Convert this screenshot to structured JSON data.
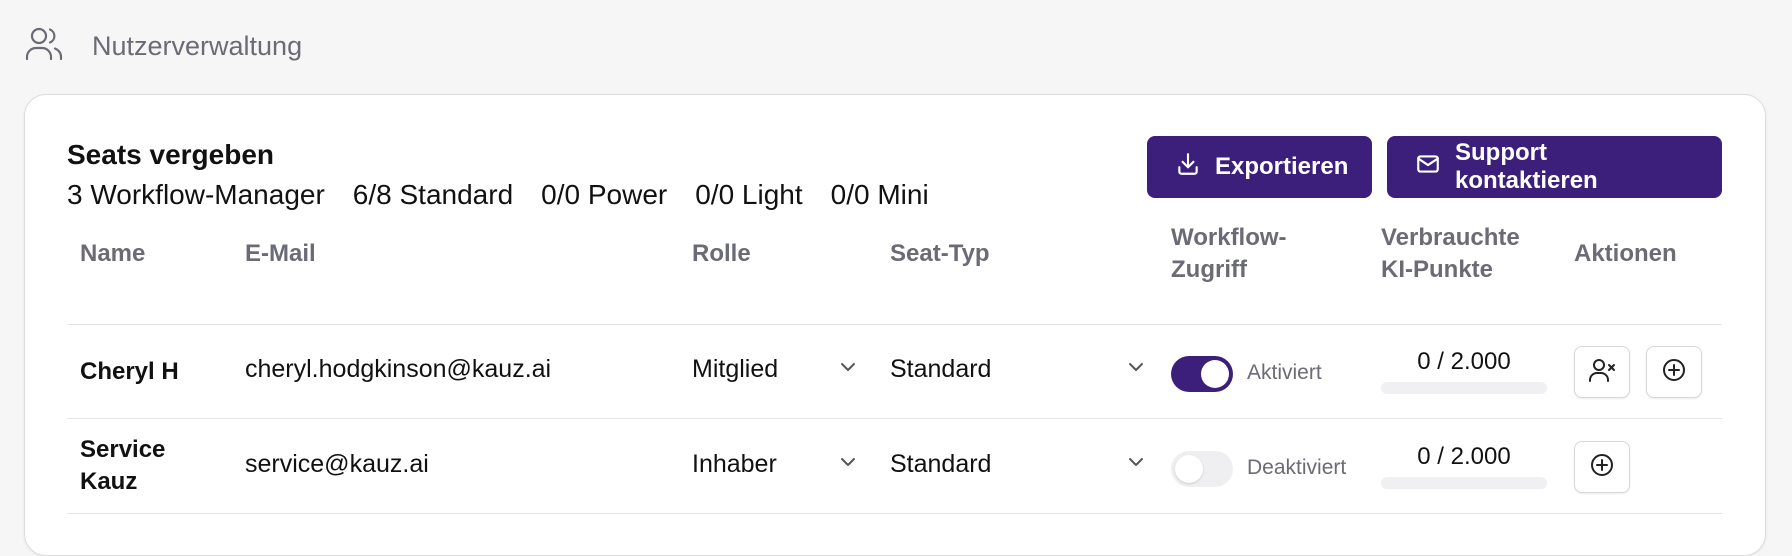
{
  "page": {
    "title": "Nutzerverwaltung",
    "icon": "users-icon"
  },
  "seats": {
    "title": "Seats vergeben",
    "items": [
      "3 Workflow-Manager",
      "6/8 Standard",
      "0/0 Power",
      "0/0 Light",
      "0/0 Mini"
    ]
  },
  "actions": {
    "export_label": "Exportieren",
    "export_icon": "download-icon",
    "support_label": "Support kontaktieren",
    "support_icon": "mail-icon"
  },
  "table": {
    "headers": {
      "name": "Name",
      "email": "E-Mail",
      "role": "Rolle",
      "seat": "Seat-Typ",
      "workflow_line1": "Workflow-",
      "workflow_line2": "Zugriff",
      "points_line1": "Verbrauchte",
      "points_line2": "KI-Punkte",
      "actions": "Aktionen"
    },
    "rows": [
      {
        "name": "Cheryl H",
        "email": "cheryl.hodgkinson@kauz.ai",
        "role": "Mitglied",
        "seat": "Standard",
        "workflow_enabled": true,
        "workflow_label": "Aktiviert",
        "points": "0 / 2.000",
        "points_fraction": 0,
        "actions": [
          "remove-user-icon",
          "plus-circle-icon"
        ]
      },
      {
        "name_line1": "Service",
        "name_line2": "Kauz",
        "email": "service@kauz.ai",
        "role": "Inhaber",
        "seat": "Standard",
        "workflow_enabled": false,
        "workflow_label": "Deaktiviert",
        "points": "0 / 2.000",
        "points_fraction": 0,
        "actions": [
          "plus-circle-icon"
        ]
      }
    ]
  },
  "colors": {
    "accent": "#3b1f7a",
    "muted_text": "#6b6b75",
    "border": "#e4e4e7"
  }
}
